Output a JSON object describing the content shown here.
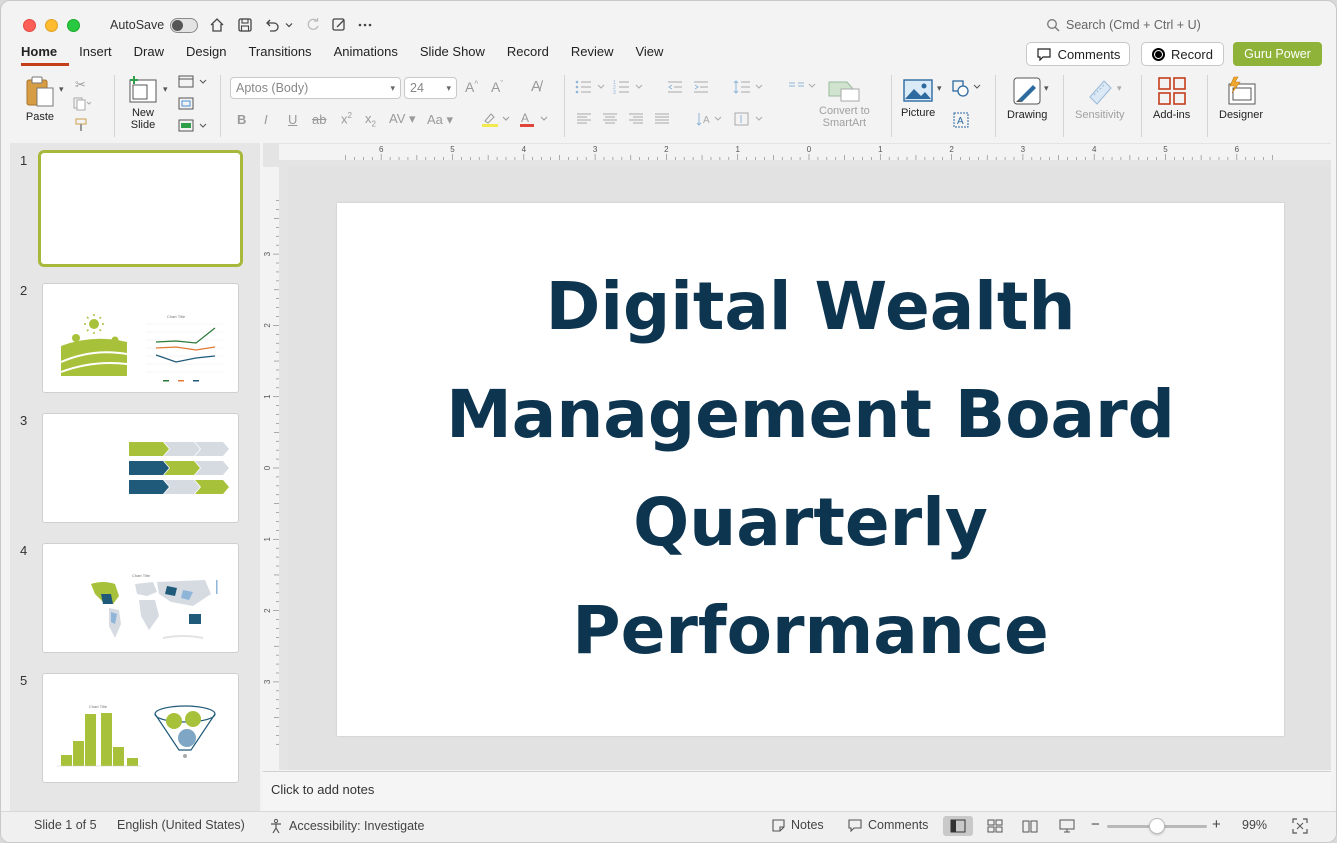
{
  "titlebar": {
    "autosave_label": "AutoSave",
    "search_placeholder": "Search (Cmd + Ctrl + U)"
  },
  "tabs": [
    "Home",
    "Insert",
    "Draw",
    "Design",
    "Transitions",
    "Animations",
    "Slide Show",
    "Record",
    "Review",
    "View"
  ],
  "header_buttons": {
    "comments": "Comments",
    "record": "Record",
    "guru": "Guru Power"
  },
  "ribbon": {
    "paste": "Paste",
    "new_slide_line1": "New",
    "new_slide_line2": "Slide",
    "font_name": "Aptos (Body)",
    "font_size": "24",
    "convert_line1": "Convert to",
    "convert_line2": "SmartArt",
    "picture": "Picture",
    "drawing": "Drawing",
    "sensitivity": "Sensitivity",
    "addins": "Add-ins",
    "designer": "Designer"
  },
  "slides": [
    {
      "num": "1"
    },
    {
      "num": "2"
    },
    {
      "num": "3"
    },
    {
      "num": "4"
    },
    {
      "num": "5"
    }
  ],
  "thumb_labels": {
    "chart_title": "Chart Title"
  },
  "ruler_top_labels": [
    "6",
    "5",
    "4",
    "3",
    "2",
    "1",
    "0",
    "1",
    "2",
    "3",
    "4",
    "5",
    "6"
  ],
  "ruler_left_labels": [
    "3",
    "2",
    "1",
    "0",
    "1",
    "2",
    "3"
  ],
  "slide": {
    "title_lines": [
      "Digital Wealth",
      "Management Board",
      "Quarterly",
      "Performance"
    ]
  },
  "notes_placeholder": "Click to add notes",
  "status": {
    "slide_count": "Slide 1 of 5",
    "language": "English (United States)",
    "accessibility": "Accessibility: Investigate",
    "notes": "Notes",
    "comments": "Comments",
    "zoom": "99%"
  },
  "colors": {
    "accent_tab": "#c43e1c",
    "guru_button": "#8fb339",
    "title_text": "#0d3550",
    "thumb_green": "#a7c23a",
    "thumb_blue": "#1f5a7a"
  }
}
